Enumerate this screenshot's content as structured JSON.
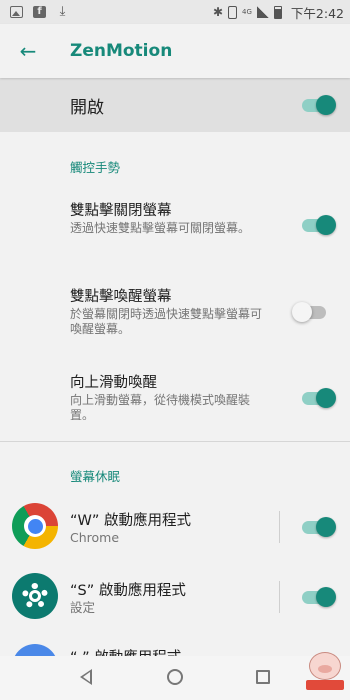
{
  "status_bar": {
    "time": "下午2:42",
    "network": "4G",
    "left_icons": [
      "image-icon",
      "facebook-icon",
      "download-icon"
    ],
    "right_icons": [
      "bluetooth-icon",
      "vibrate-icon",
      "signal-icon",
      "battery-icon"
    ]
  },
  "app_bar": {
    "title": "ZenMotion",
    "back_icon": "arrow-left-icon"
  },
  "master_toggle": {
    "label": "開啟",
    "enabled": true
  },
  "sections": [
    {
      "header": "觸控手勢",
      "items": [
        {
          "title": "雙點擊關閉螢幕",
          "subtitle": "透過快速雙點擊螢幕可關閉螢幕。",
          "enabled": true
        },
        {
          "title": "雙點擊喚醒螢幕",
          "subtitle": "於螢幕關閉時透過快速雙點擊螢幕可喚醒螢幕。",
          "enabled": false
        },
        {
          "title": "向上滑動喚醒",
          "subtitle": "向上滑動螢幕，從待機模式喚醒裝置。",
          "enabled": true
        }
      ]
    },
    {
      "header": "螢幕休眠",
      "items": [
        {
          "title": "“W” 啟動應用程式",
          "subtitle": "Chrome",
          "icon": "chrome-icon",
          "enabled": true
        },
        {
          "title": "“S” 啟動應用程式",
          "subtitle": "設定",
          "icon": "settings-gear-icon",
          "enabled": true
        },
        {
          "title": "“ ” 啟動應用程式",
          "icon": "app-icon"
        }
      ]
    }
  ],
  "colors": {
    "accent": "#17897a",
    "toggle_track_on": "#8fcfc5",
    "master_background": "#e0e0e0"
  },
  "nav_bar": {
    "icons": [
      "nav-back-icon",
      "nav-home-icon",
      "nav-recents-icon"
    ]
  }
}
